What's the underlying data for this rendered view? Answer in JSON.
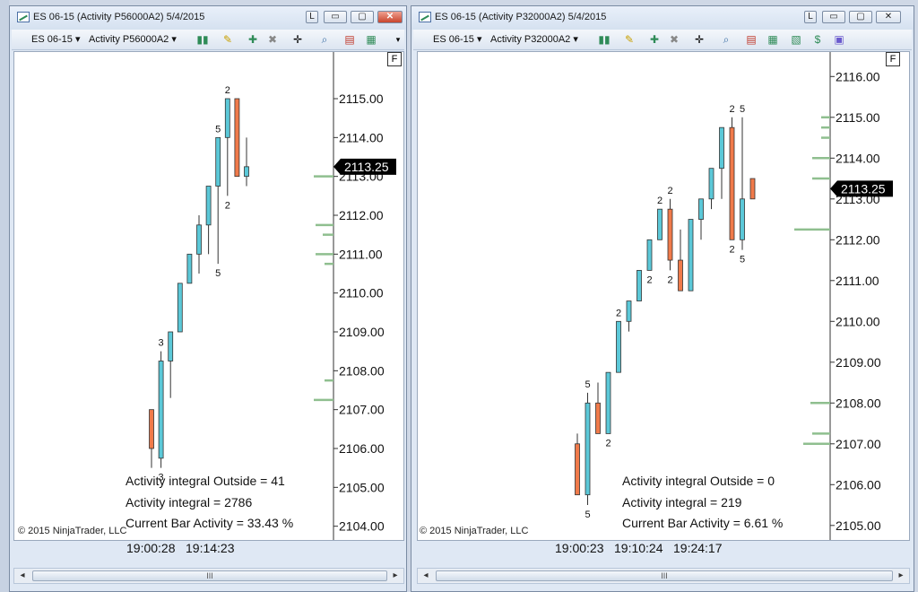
{
  "windows": [
    {
      "title": "ES 06-15 (Activity P56000A2)  5/4/2015",
      "instrument": "ES 06-15",
      "indicator": "Activity P56000A2",
      "buttons": {
        "link": "L",
        "minimize": "▭",
        "maximize": "▢",
        "close": "✕"
      },
      "f_label": "F",
      "price_levels": [
        "2115.00",
        "2114.00",
        "2113.00",
        "2112.00",
        "2111.00",
        "2110.00",
        "2109.00",
        "2108.00",
        "2107.00",
        "2106.00",
        "2105.00",
        "2104.00"
      ],
      "current_price": "2113.25",
      "overlay": {
        "outside": "Activity integral Outside  = 41",
        "integral": "Activity integral = 2786",
        "current": "Current Bar Activity = 33.43 %"
      },
      "copyright": "© 2015 NinjaTrader, LLC",
      "time_labels": [
        "19:00:28",
        "19:14:23"
      ],
      "scroll_thumb": "III"
    },
    {
      "title": "ES 06-15 (Activity P32000A2)  5/4/2015",
      "instrument": "ES 06-15",
      "indicator": "Activity P32000A2",
      "buttons": {
        "link": "L",
        "minimize": "▭",
        "maximize": "▢",
        "close": "✕"
      },
      "f_label": "F",
      "price_levels": [
        "2116.00",
        "2115.00",
        "2114.00",
        "2113.00",
        "2112.00",
        "2111.00",
        "2110.00",
        "2109.00",
        "2108.00",
        "2107.00",
        "2106.00",
        "2105.00"
      ],
      "current_price": "2113.25",
      "overlay": {
        "outside": "Activity integral Outside  = 0",
        "integral": "Activity integral = 219",
        "current": "Current Bar Activity = 6.61 %"
      },
      "copyright": "© 2015 NinjaTrader, LLC",
      "time_labels": [
        "19:00:23",
        "19:10:24",
        "19:24:17"
      ],
      "scroll_thumb": "III"
    }
  ],
  "colors": {
    "up_bar": "#5bc8d8",
    "down_bar": "#f07a4a",
    "volume_profile": "#8fbf8f",
    "price_tag": "#000000"
  },
  "icons": [
    "chart-style-icon",
    "draw-pencil-icon",
    "add-indicator-icon",
    "remove-indicator-icon",
    "crosshair-icon",
    "zoom-icon",
    "strategy-icon",
    "data-box-icon",
    "chart-trader-icon",
    "properties-icon"
  ],
  "chart_data": [
    {
      "type": "candlestick",
      "y_range": [
        2103.6,
        2116.2
      ],
      "bars": [
        {
          "o": 2106.0,
          "h": 2106.3,
          "l": 2105.5,
          "c": 2107.0,
          "up": false,
          "label_top": "",
          "label_bot": ""
        },
        {
          "o": 2105.75,
          "h": 2108.5,
          "l": 2105.5,
          "c": 2108.25,
          "up": true,
          "label_top": "3",
          "label_bot": "3"
        },
        {
          "o": 2108.25,
          "h": 2109.0,
          "l": 2107.3,
          "c": 2109.0,
          "up": true,
          "label_top": "",
          "label_bot": ""
        },
        {
          "o": 2109.0,
          "h": 2110.25,
          "l": 2109.0,
          "c": 2110.25,
          "up": true,
          "label_top": "",
          "label_bot": ""
        },
        {
          "o": 2110.25,
          "h": 2111.0,
          "l": 2110.25,
          "c": 2111.0,
          "up": true,
          "label_top": "",
          "label_bot": ""
        },
        {
          "o": 2111.0,
          "h": 2112.0,
          "l": 2110.5,
          "c": 2111.75,
          "up": true,
          "label_top": "",
          "label_bot": ""
        },
        {
          "o": 2111.75,
          "h": 2112.75,
          "l": 2111.0,
          "c": 2112.75,
          "up": true,
          "label_top": "",
          "label_bot": ""
        },
        {
          "o": 2112.75,
          "h": 2114.0,
          "l": 2110.75,
          "c": 2114.0,
          "up": true,
          "label_top": "5",
          "label_bot": "5"
        },
        {
          "o": 2114.0,
          "h": 2115.0,
          "l": 2112.5,
          "c": 2115.0,
          "up": true,
          "label_top": "2",
          "label_bot": "2"
        },
        {
          "o": 2115.0,
          "h": 2115.0,
          "l": 2113.0,
          "c": 2113.0,
          "up": false,
          "label_top": "",
          "label_bot": ""
        },
        {
          "o": 2113.0,
          "h": 2114.0,
          "l": 2112.75,
          "c": 2113.25,
          "up": true,
          "label_top": "",
          "label_bot": ""
        }
      ],
      "volume_profile": [
        {
          "price": 2113.0,
          "len": 22
        },
        {
          "price": 2111.75,
          "len": 20
        },
        {
          "price": 2111.5,
          "len": 12
        },
        {
          "price": 2111.0,
          "len": 20
        },
        {
          "price": 2110.75,
          "len": 10
        },
        {
          "price": 2107.75,
          "len": 10
        },
        {
          "price": 2107.25,
          "len": 22
        }
      ]
    },
    {
      "type": "candlestick",
      "y_range": [
        2104.6,
        2116.6
      ],
      "bars": [
        {
          "o": 2107.0,
          "h": 2107.25,
          "l": 2105.75,
          "c": 2105.75,
          "up": false,
          "label_top": "",
          "label_bot": ""
        },
        {
          "o": 2105.75,
          "h": 2108.25,
          "l": 2105.5,
          "c": 2108.0,
          "up": true,
          "label_top": "5",
          "label_bot": "5"
        },
        {
          "o": 2108.0,
          "h": 2108.5,
          "l": 2107.25,
          "c": 2107.25,
          "up": false,
          "label_top": "",
          "label_bot": ""
        },
        {
          "o": 2107.25,
          "h": 2108.75,
          "l": 2107.25,
          "c": 2108.75,
          "up": true,
          "label_top": "",
          "label_bot": "2"
        },
        {
          "o": 2108.75,
          "h": 2110.0,
          "l": 2108.75,
          "c": 2110.0,
          "up": true,
          "label_top": "2",
          "label_bot": ""
        },
        {
          "o": 2110.0,
          "h": 2110.5,
          "l": 2109.75,
          "c": 2110.5,
          "up": true,
          "label_top": "",
          "label_bot": ""
        },
        {
          "o": 2110.5,
          "h": 2111.25,
          "l": 2110.5,
          "c": 2111.25,
          "up": true,
          "label_top": "",
          "label_bot": ""
        },
        {
          "o": 2111.25,
          "h": 2112.0,
          "l": 2111.25,
          "c": 2112.0,
          "up": true,
          "label_top": "",
          "label_bot": "2"
        },
        {
          "o": 2112.0,
          "h": 2112.75,
          "l": 2112.0,
          "c": 2112.75,
          "up": true,
          "label_top": "2",
          "label_bot": ""
        },
        {
          "o": 2112.75,
          "h": 2113.0,
          "l": 2111.25,
          "c": 2111.5,
          "up": false,
          "label_top": "2",
          "label_bot": "2"
        },
        {
          "o": 2111.5,
          "h": 2112.25,
          "l": 2110.75,
          "c": 2110.75,
          "up": false,
          "label_top": "",
          "label_bot": ""
        },
        {
          "o": 2110.75,
          "h": 2112.5,
          "l": 2110.75,
          "c": 2112.5,
          "up": true,
          "label_top": "",
          "label_bot": ""
        },
        {
          "o": 2112.5,
          "h": 2113.0,
          "l": 2112.0,
          "c": 2113.0,
          "up": true,
          "label_top": "",
          "label_bot": ""
        },
        {
          "o": 2113.0,
          "h": 2113.75,
          "l": 2112.75,
          "c": 2113.75,
          "up": true,
          "label_top": "",
          "label_bot": ""
        },
        {
          "o": 2113.75,
          "h": 2114.75,
          "l": 2113.0,
          "c": 2114.75,
          "up": true,
          "label_top": "",
          "label_bot": ""
        },
        {
          "o": 2114.75,
          "h": 2115.0,
          "l": 2112.0,
          "c": 2112.0,
          "up": false,
          "label_top": "2",
          "label_bot": "2"
        },
        {
          "o": 2112.0,
          "h": 2115.0,
          "l": 2111.75,
          "c": 2113.0,
          "up": true,
          "label_top": "5",
          "label_bot": "5"
        },
        {
          "o": 2113.5,
          "h": 2113.5,
          "l": 2113.0,
          "c": 2113.0,
          "up": false,
          "label_top": "",
          "label_bot": ""
        }
      ],
      "volume_profile": [
        {
          "price": 2115.0,
          "len": 10
        },
        {
          "price": 2114.75,
          "len": 10
        },
        {
          "price": 2114.5,
          "len": 10
        },
        {
          "price": 2114.0,
          "len": 20
        },
        {
          "price": 2113.5,
          "len": 20
        },
        {
          "price": 2112.25,
          "len": 40
        },
        {
          "price": 2108.0,
          "len": 22
        },
        {
          "price": 2107.25,
          "len": 20
        },
        {
          "price": 2107.0,
          "len": 30
        }
      ]
    }
  ]
}
